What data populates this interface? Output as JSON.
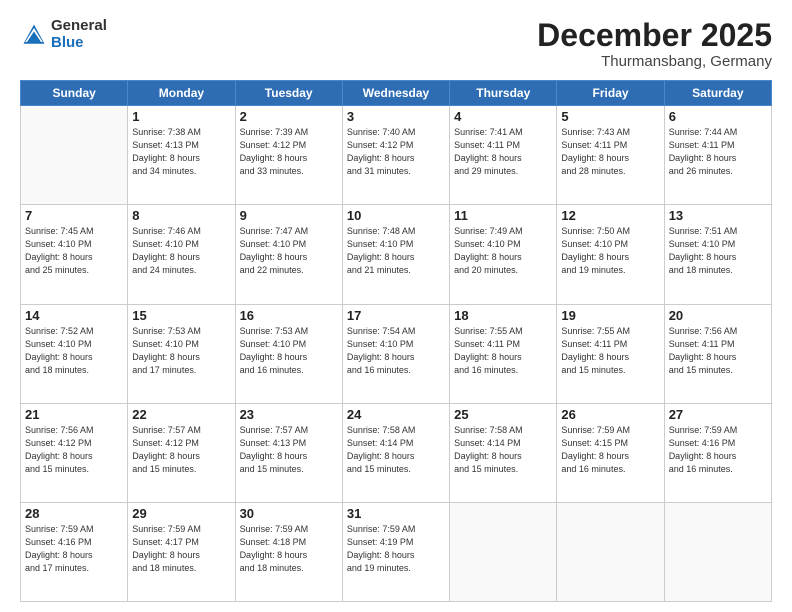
{
  "logo": {
    "general": "General",
    "blue": "Blue"
  },
  "title": {
    "month": "December 2025",
    "location": "Thurmansbang, Germany"
  },
  "days_header": [
    "Sunday",
    "Monday",
    "Tuesday",
    "Wednesday",
    "Thursday",
    "Friday",
    "Saturday"
  ],
  "weeks": [
    [
      {
        "day": "",
        "info": ""
      },
      {
        "day": "1",
        "info": "Sunrise: 7:38 AM\nSunset: 4:13 PM\nDaylight: 8 hours\nand 34 minutes."
      },
      {
        "day": "2",
        "info": "Sunrise: 7:39 AM\nSunset: 4:12 PM\nDaylight: 8 hours\nand 33 minutes."
      },
      {
        "day": "3",
        "info": "Sunrise: 7:40 AM\nSunset: 4:12 PM\nDaylight: 8 hours\nand 31 minutes."
      },
      {
        "day": "4",
        "info": "Sunrise: 7:41 AM\nSunset: 4:11 PM\nDaylight: 8 hours\nand 29 minutes."
      },
      {
        "day": "5",
        "info": "Sunrise: 7:43 AM\nSunset: 4:11 PM\nDaylight: 8 hours\nand 28 minutes."
      },
      {
        "day": "6",
        "info": "Sunrise: 7:44 AM\nSunset: 4:11 PM\nDaylight: 8 hours\nand 26 minutes."
      }
    ],
    [
      {
        "day": "7",
        "info": "Sunrise: 7:45 AM\nSunset: 4:10 PM\nDaylight: 8 hours\nand 25 minutes."
      },
      {
        "day": "8",
        "info": "Sunrise: 7:46 AM\nSunset: 4:10 PM\nDaylight: 8 hours\nand 24 minutes."
      },
      {
        "day": "9",
        "info": "Sunrise: 7:47 AM\nSunset: 4:10 PM\nDaylight: 8 hours\nand 22 minutes."
      },
      {
        "day": "10",
        "info": "Sunrise: 7:48 AM\nSunset: 4:10 PM\nDaylight: 8 hours\nand 21 minutes."
      },
      {
        "day": "11",
        "info": "Sunrise: 7:49 AM\nSunset: 4:10 PM\nDaylight: 8 hours\nand 20 minutes."
      },
      {
        "day": "12",
        "info": "Sunrise: 7:50 AM\nSunset: 4:10 PM\nDaylight: 8 hours\nand 19 minutes."
      },
      {
        "day": "13",
        "info": "Sunrise: 7:51 AM\nSunset: 4:10 PM\nDaylight: 8 hours\nand 18 minutes."
      }
    ],
    [
      {
        "day": "14",
        "info": "Sunrise: 7:52 AM\nSunset: 4:10 PM\nDaylight: 8 hours\nand 18 minutes."
      },
      {
        "day": "15",
        "info": "Sunrise: 7:53 AM\nSunset: 4:10 PM\nDaylight: 8 hours\nand 17 minutes."
      },
      {
        "day": "16",
        "info": "Sunrise: 7:53 AM\nSunset: 4:10 PM\nDaylight: 8 hours\nand 16 minutes."
      },
      {
        "day": "17",
        "info": "Sunrise: 7:54 AM\nSunset: 4:10 PM\nDaylight: 8 hours\nand 16 minutes."
      },
      {
        "day": "18",
        "info": "Sunrise: 7:55 AM\nSunset: 4:11 PM\nDaylight: 8 hours\nand 16 minutes."
      },
      {
        "day": "19",
        "info": "Sunrise: 7:55 AM\nSunset: 4:11 PM\nDaylight: 8 hours\nand 15 minutes."
      },
      {
        "day": "20",
        "info": "Sunrise: 7:56 AM\nSunset: 4:11 PM\nDaylight: 8 hours\nand 15 minutes."
      }
    ],
    [
      {
        "day": "21",
        "info": "Sunrise: 7:56 AM\nSunset: 4:12 PM\nDaylight: 8 hours\nand 15 minutes."
      },
      {
        "day": "22",
        "info": "Sunrise: 7:57 AM\nSunset: 4:12 PM\nDaylight: 8 hours\nand 15 minutes."
      },
      {
        "day": "23",
        "info": "Sunrise: 7:57 AM\nSunset: 4:13 PM\nDaylight: 8 hours\nand 15 minutes."
      },
      {
        "day": "24",
        "info": "Sunrise: 7:58 AM\nSunset: 4:14 PM\nDaylight: 8 hours\nand 15 minutes."
      },
      {
        "day": "25",
        "info": "Sunrise: 7:58 AM\nSunset: 4:14 PM\nDaylight: 8 hours\nand 15 minutes."
      },
      {
        "day": "26",
        "info": "Sunrise: 7:59 AM\nSunset: 4:15 PM\nDaylight: 8 hours\nand 16 minutes."
      },
      {
        "day": "27",
        "info": "Sunrise: 7:59 AM\nSunset: 4:16 PM\nDaylight: 8 hours\nand 16 minutes."
      }
    ],
    [
      {
        "day": "28",
        "info": "Sunrise: 7:59 AM\nSunset: 4:16 PM\nDaylight: 8 hours\nand 17 minutes."
      },
      {
        "day": "29",
        "info": "Sunrise: 7:59 AM\nSunset: 4:17 PM\nDaylight: 8 hours\nand 18 minutes."
      },
      {
        "day": "30",
        "info": "Sunrise: 7:59 AM\nSunset: 4:18 PM\nDaylight: 8 hours\nand 18 minutes."
      },
      {
        "day": "31",
        "info": "Sunrise: 7:59 AM\nSunset: 4:19 PM\nDaylight: 8 hours\nand 19 minutes."
      },
      {
        "day": "",
        "info": ""
      },
      {
        "day": "",
        "info": ""
      },
      {
        "day": "",
        "info": ""
      }
    ]
  ]
}
